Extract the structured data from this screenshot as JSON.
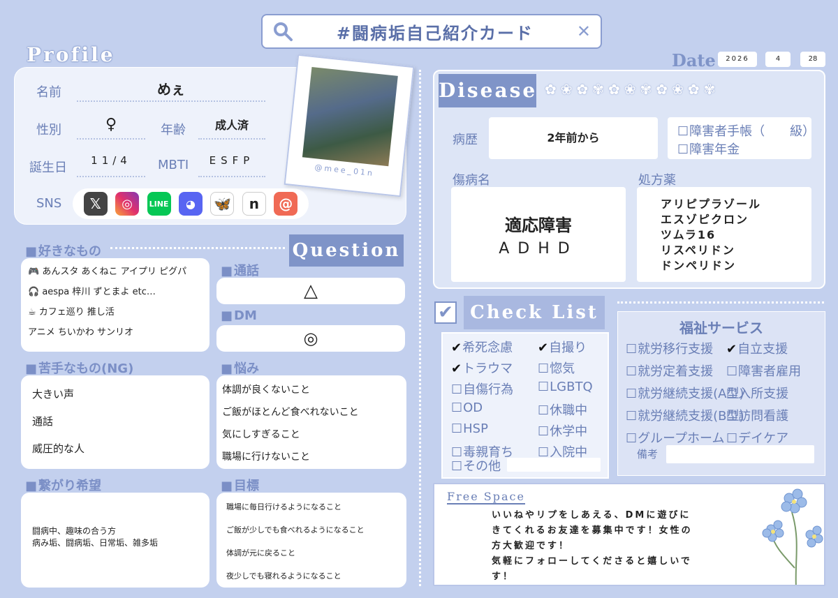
{
  "header": {
    "title": "#闘病垢自己紹介カード"
  },
  "date": {
    "label": "Date",
    "year": "2026",
    "month": "4",
    "day": "28"
  },
  "profile": {
    "heading": "Profile",
    "name_label": "名前",
    "name": "めぇ",
    "gender_label": "性別",
    "gender": "♀",
    "age_label": "年齢",
    "age": "成人済",
    "birthday_label": "誕生日",
    "birthday": "11/4",
    "mbti_label": "MBTI",
    "mbti": "ESFP",
    "sns_label": "SNS",
    "sns": [
      "X",
      "Instagram",
      "LINE",
      "Discord",
      "Bluesky",
      "note",
      "Threads"
    ],
    "photo_caption": "@mee_01n"
  },
  "likes": {
    "heading": "好きなもの",
    "items": [
      "🎮 あんスタ あくねこ アイプリ ピグパ",
      "🎧 aespa 梓川 ずとまよ etc…",
      "☕ カフェ巡り 推し活",
      "アニメ ちいかわ サンリオ"
    ]
  },
  "dislikes": {
    "heading": "苦手なもの(NG)",
    "items": [
      "大きい声",
      "通話",
      "威圧的な人"
    ]
  },
  "connect": {
    "heading": "繋がり希望",
    "items": [
      "闘病中、趣味の合う方",
      "病み垢、闘病垢、日常垢、雑多垢"
    ]
  },
  "question": {
    "heading": "Question",
    "call_label": "通話",
    "call": "△",
    "dm_label": "DM",
    "dm": "◎",
    "worry_label": "悩み",
    "worries": [
      "体調が良くないこと",
      "ご飯がほとんど食べれないこと",
      "気にしすぎること",
      "職場に行けないこと"
    ],
    "goal_label": "目標",
    "goals": [
      "職場に毎日行けるようになること",
      "ご飯が少しでも食べれるようになること",
      "体調が元に戻ること",
      "夜少しでも寝れるようになること"
    ]
  },
  "disease": {
    "heading": "Disease",
    "history_label": "病歴",
    "history": "2年前から",
    "handbook": "障害者手帳（　　級）",
    "pension": "障害年金",
    "diagnosis_label": "傷病名",
    "diagnoses": [
      "適応障害",
      "ADHD"
    ],
    "medicine_label": "処方薬",
    "medicines": [
      "アリピプラゾール",
      "エスゾピクロン",
      "ツムラ16",
      "リスペリドン",
      "ドンペリドン"
    ]
  },
  "checklist": {
    "heading": "Check List",
    "items": [
      {
        "label": "希死念慮",
        "checked": true
      },
      {
        "label": "自撮り",
        "checked": true
      },
      {
        "label": "トラウマ",
        "checked": true
      },
      {
        "label": "惚気",
        "checked": false
      },
      {
        "label": "自傷行為",
        "checked": false
      },
      {
        "label": "LGBTQ",
        "checked": false
      },
      {
        "label": "OD",
        "checked": false
      },
      {
        "label": "休職中",
        "checked": false
      },
      {
        "label": "HSP",
        "checked": false
      },
      {
        "label": "休学中",
        "checked": false
      },
      {
        "label": "毒親育ち",
        "checked": false
      },
      {
        "label": "入院中",
        "checked": false
      }
    ],
    "other": "その他"
  },
  "welfare": {
    "heading": "福祉サービス",
    "items": [
      {
        "label": "就労移行支援",
        "checked": false
      },
      {
        "label": "自立支援",
        "checked": true
      },
      {
        "label": "就労定着支援",
        "checked": false
      },
      {
        "label": "障害者雇用",
        "checked": false
      },
      {
        "label": "就労継続支援(A型)",
        "checked": false
      },
      {
        "label": "入所支援",
        "checked": false
      },
      {
        "label": "就労継続支援(B型)",
        "checked": false
      },
      {
        "label": "訪問看護",
        "checked": false
      },
      {
        "label": "グループホーム",
        "checked": false
      },
      {
        "label": "デイケア",
        "checked": false
      }
    ],
    "note_label": "備考"
  },
  "free_space": {
    "heading": "Free Space",
    "lines": [
      "いいねやリプをしあえる、DMに遊びに",
      "きてくれるお友達を募集中です！女性の",
      "方大歓迎です！",
      "気軽にフォローしてくださると嬉しいで",
      "す！"
    ]
  },
  "colors": {
    "background": "#c3d0ee",
    "accent": "#7f94c8",
    "text": "#6a7fb6"
  }
}
